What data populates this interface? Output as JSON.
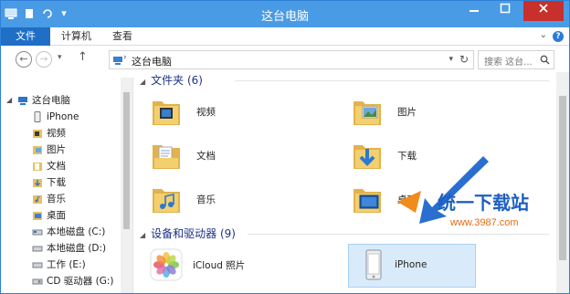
{
  "window": {
    "title": "这台电脑",
    "colors": {
      "titlebar": "#4a9be6",
      "file_tab": "#1f6fc7",
      "close": "#c7302b",
      "group_header": "#1e3287",
      "selection": "#d9ebfa"
    }
  },
  "ribbon": {
    "tabs": [
      "文件",
      "计算机",
      "查看"
    ]
  },
  "navbar": {
    "address": "这台电脑",
    "search_placeholder": "搜索 这台...",
    "search_icon": "magnifier-icon"
  },
  "sidebar": {
    "items": [
      {
        "label": "这台电脑",
        "icon": "computer-icon"
      },
      {
        "label": "iPhone",
        "icon": "iphone-icon"
      },
      {
        "label": "视频",
        "icon": "video-folder-icon"
      },
      {
        "label": "图片",
        "icon": "pictures-folder-icon"
      },
      {
        "label": "文档",
        "icon": "documents-folder-icon"
      },
      {
        "label": "下载",
        "icon": "downloads-folder-icon"
      },
      {
        "label": "音乐",
        "icon": "music-folder-icon"
      },
      {
        "label": "桌面",
        "icon": "desktop-folder-icon"
      },
      {
        "label": "本地磁盘 (C:)",
        "icon": "drive-icon"
      },
      {
        "label": "本地磁盘 (D:)",
        "icon": "drive-icon"
      },
      {
        "label": "工作 (E:)",
        "icon": "drive-icon"
      },
      {
        "label": "CD 驱动器 (G:)",
        "icon": "cd-drive-icon"
      }
    ]
  },
  "main": {
    "folders_header": "文件夹 (6)",
    "folders": [
      {
        "label": "视频",
        "icon": "video-folder-icon"
      },
      {
        "label": "图片",
        "icon": "pictures-folder-icon"
      },
      {
        "label": "文档",
        "icon": "documents-folder-icon"
      },
      {
        "label": "下载",
        "icon": "downloads-folder-icon"
      },
      {
        "label": "音乐",
        "icon": "music-folder-icon"
      },
      {
        "label": "桌面",
        "icon": "desktop-folder-icon"
      }
    ],
    "devices_header": "设备和驱动器 (9)",
    "devices": [
      {
        "label": "iCloud 照片",
        "icon": "icloud-photos-icon"
      },
      {
        "label": "iPhone",
        "icon": "iphone-device-icon"
      }
    ]
  },
  "watermark": {
    "name": "统一下载站",
    "url": "www.3987.com"
  }
}
